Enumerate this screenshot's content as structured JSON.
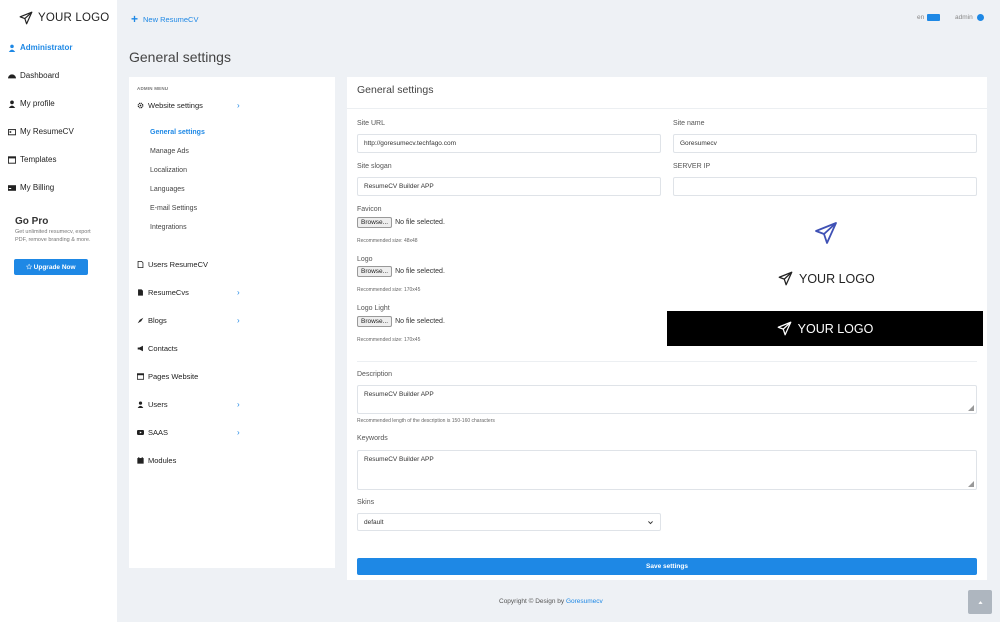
{
  "brand": {
    "logo_text": "YOUR LOGO"
  },
  "sidebar": {
    "items": [
      {
        "label": "Administrator",
        "icon": "user-shield-icon"
      },
      {
        "label": "Dashboard",
        "icon": "dashboard-icon"
      },
      {
        "label": "My profile",
        "icon": "user-icon"
      },
      {
        "label": "My ResumeCV",
        "icon": "id-card-icon"
      },
      {
        "label": "Templates",
        "icon": "window-icon"
      },
      {
        "label": "My Billing",
        "icon": "credit-card-icon"
      }
    ],
    "gopro": {
      "title": "Go Pro",
      "text": "Get unlimited resumecv, export PDF, remove branding & more.",
      "button": "✩ Upgrade Now"
    }
  },
  "topbar": {
    "new_resume": "New ResumeCV",
    "lang": "en",
    "user": "admin"
  },
  "page_title": "General settings",
  "admin_menu": {
    "heading": "ADMIN MENU",
    "website_settings": "Website settings",
    "sub_items": [
      "General settings",
      "Manage Ads",
      "Localization",
      "Languages",
      "E-mail Settings",
      "Integrations"
    ],
    "items": [
      {
        "label": "Users ResumeCV",
        "chevron": false
      },
      {
        "label": "ResumeCvs",
        "chevron": true
      },
      {
        "label": "Blogs",
        "chevron": true
      },
      {
        "label": "Contacts",
        "chevron": false
      },
      {
        "label": "Pages Website",
        "chevron": false
      },
      {
        "label": "Users",
        "chevron": true
      },
      {
        "label": "SAAS",
        "chevron": true
      },
      {
        "label": "Modules",
        "chevron": false
      }
    ]
  },
  "settings": {
    "title": "General settings",
    "site_url_label": "Site URL",
    "site_url_value": "http://goresumecv.techfago.com",
    "site_name_label": "Site name",
    "site_name_value": "Goresumecv",
    "site_slogan_label": "Site slogan",
    "site_slogan_value": "ResumeCV Builder APP",
    "server_ip_label": "SERVER IP",
    "server_ip_value": "",
    "favicon_label": "Favicon",
    "favicon_hint": "Recommended size: 48x48",
    "logo_label": "Logo",
    "logo_hint": "Recommended size: 170x45",
    "logo_light_label": "Logo Light",
    "logo_light_hint": "Recommended size: 170x45",
    "browse": "Browse...",
    "no_file": "No file selected.",
    "description_label": "Description",
    "description_value": "ResumeCV Builder APP",
    "description_hint": "Recommended length of the description is 150-160 characters",
    "keywords_label": "Keywords",
    "keywords_value": "ResumeCV Builder APP",
    "skins_label": "Skins",
    "skins_value": "default",
    "save": "Save settings",
    "preview_logo_text": "YOUR LOGO"
  },
  "footer": {
    "copyright": "Copyright © Design by",
    "link": "Goresumecv"
  },
  "colors": {
    "accent": "#1e88e5",
    "background": "#eef1f5"
  }
}
